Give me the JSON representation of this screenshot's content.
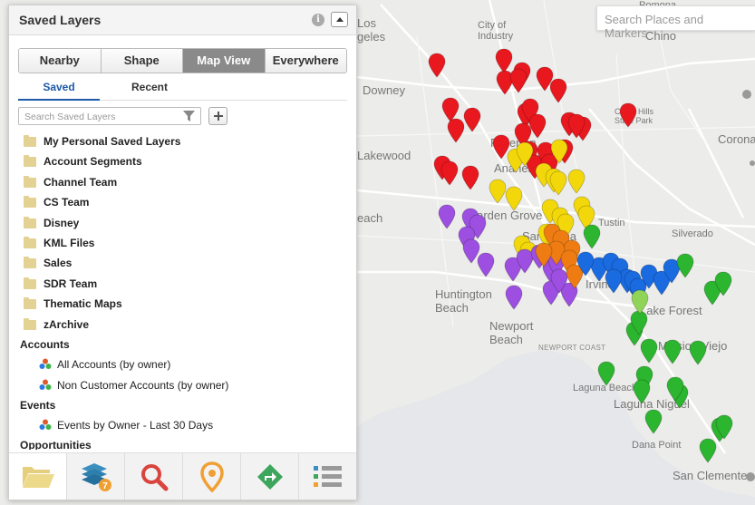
{
  "panel": {
    "title": "Saved Layers",
    "segments": [
      {
        "label": "Nearby",
        "active": false
      },
      {
        "label": "Shape",
        "active": false
      },
      {
        "label": "Map View",
        "active": true
      },
      {
        "label": "Everywhere",
        "active": false
      }
    ],
    "tabs": [
      {
        "label": "Saved",
        "active": true
      },
      {
        "label": "Recent",
        "active": false
      }
    ],
    "search_placeholder": "Search Saved Layers",
    "folders": [
      "My Personal Saved Layers",
      "Account Segments",
      "Channel Team",
      "CS Team",
      "Disney",
      "KML Files",
      "Sales",
      "SDR Team",
      "Thematic Maps",
      "zArchive"
    ],
    "sections": [
      {
        "title": "Accounts",
        "layers": [
          "All Accounts (by owner)",
          "Non Customer Accounts (by owner)"
        ]
      },
      {
        "title": "Events",
        "layers": [
          "Events by Owner - Last 30 Days"
        ]
      },
      {
        "title": "Opportunities",
        "layers": []
      }
    ],
    "bottom_bar": [
      {
        "icon": "folder-open-icon",
        "active": true
      },
      {
        "icon": "layers-icon",
        "badge": "7"
      },
      {
        "icon": "magnifier-icon"
      },
      {
        "icon": "location-pin-icon"
      },
      {
        "icon": "route-arrow-icon"
      },
      {
        "icon": "list-icon"
      }
    ]
  },
  "map": {
    "search_placeholder": "Search Places and Markers",
    "places": [
      "Los\nAngeles",
      "City of\nIndustry",
      "Chino",
      "Downey",
      "Chino Hills\nState Park",
      "Lakewood",
      "Corona",
      "Fullerton",
      "Anaheim",
      "Garden Grove",
      "Santa Ana",
      "Tustin",
      "Silverado",
      "each",
      "Huntington\nBeach",
      "Newport\nBeach",
      "NEWPORT COAST",
      "Irvine",
      "Lake Forest",
      "Mission Viejo",
      "Laguna Beach",
      "Laguna Niguel",
      "Dana Point",
      "San Clemente",
      "Pomona"
    ],
    "marker_colors": {
      "red": "#e8181e",
      "yellow": "#f2d80a",
      "purple": "#9c4fe0",
      "orange": "#ef7c13",
      "blue": "#1a6ae0",
      "green": "#2cb52e",
      "lightgreen": "#8fd457"
    }
  }
}
